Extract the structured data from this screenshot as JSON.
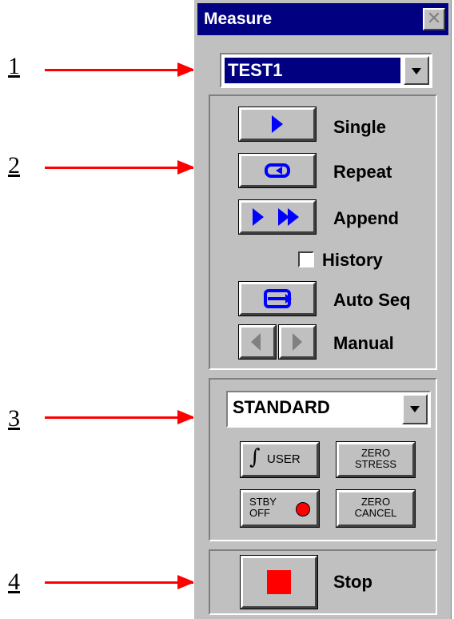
{
  "callouts": [
    "1",
    "2",
    "3",
    "4"
  ],
  "window": {
    "title": "Measure"
  },
  "test_selector": {
    "value": "TEST1"
  },
  "acquisition": {
    "single_label": "Single",
    "repeat_label": "Repeat",
    "append_label": "Append",
    "history_label": "History",
    "history_checked": false,
    "auto_seq_label": "Auto Seq",
    "manual_label": "Manual"
  },
  "mode": {
    "selected": "STANDARD",
    "user_label": "USER",
    "zero_stress_label": [
      "ZERO",
      "STRESS"
    ],
    "stby_label": [
      "STBY",
      "OFF"
    ],
    "zero_cancel_label": [
      "ZERO",
      "CANCEL"
    ]
  },
  "stop": {
    "label": "Stop"
  },
  "colors": {
    "title_bar": "#000080",
    "accent_blue": "#0000ff",
    "stop_red": "#ff0000",
    "arrow_red": "#ff0000"
  }
}
